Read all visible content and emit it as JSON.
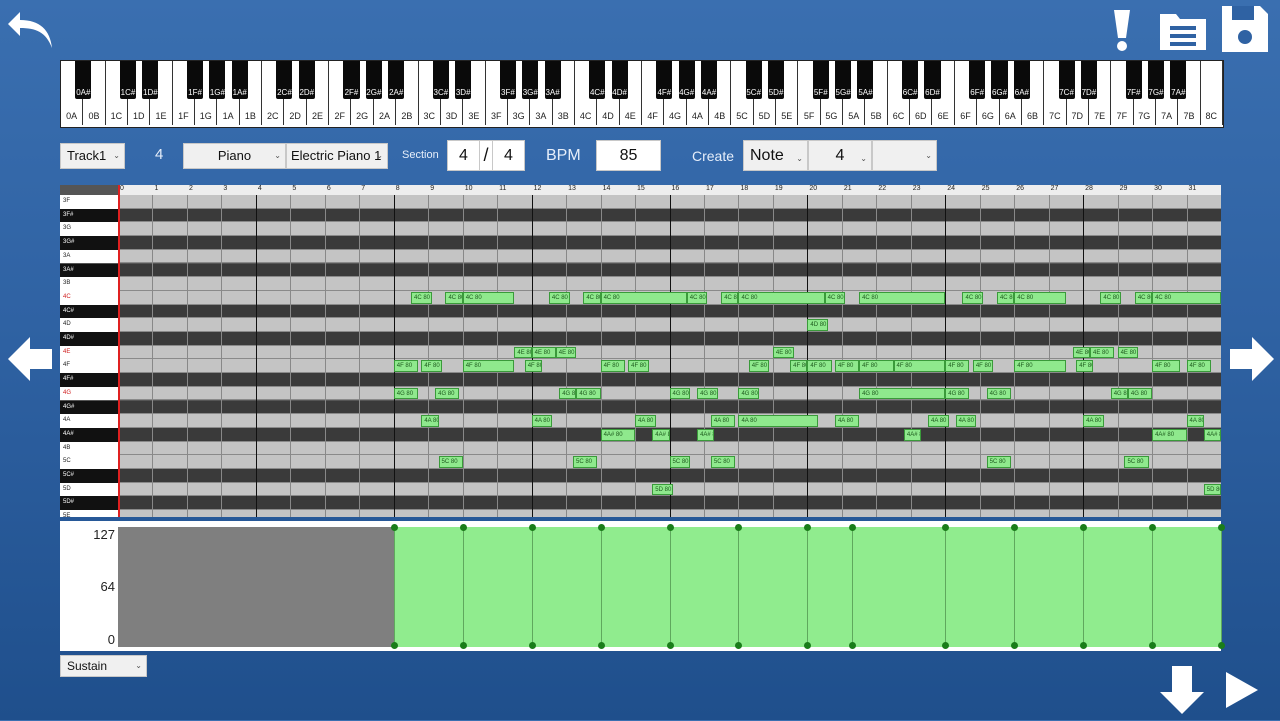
{
  "keyboard": {
    "white_keys": [
      "0A",
      "0B",
      "1C",
      "1D",
      "1E",
      "1F",
      "1G",
      "1A",
      "1B",
      "2C",
      "2D",
      "2E",
      "2F",
      "2G",
      "2A",
      "2B",
      "3C",
      "3D",
      "3E",
      "3F",
      "3G",
      "3A",
      "3B",
      "4C",
      "4D",
      "4E",
      "4F",
      "4G",
      "4A",
      "4B",
      "5C",
      "5D",
      "5E",
      "5F",
      "5G",
      "5A",
      "5B",
      "6C",
      "6D",
      "6E",
      "6F",
      "6G",
      "6A",
      "6B",
      "7C",
      "7D",
      "7E",
      "7F",
      "7G",
      "7A",
      "7B",
      "8C"
    ],
    "black_keys": [
      "0A#",
      "1C#",
      "1D#",
      "1F#",
      "1G#",
      "1A#",
      "2C#",
      "2D#",
      "2F#",
      "2G#",
      "2A#",
      "3C#",
      "3D#",
      "3F#",
      "3G#",
      "3A#",
      "4C#",
      "4D#",
      "4F#",
      "4G#",
      "4A#",
      "5C#",
      "5D#",
      "5F#",
      "5G#",
      "5A#",
      "6C#",
      "6D#",
      "6F#",
      "6G#",
      "6A#",
      "7C#",
      "7D#",
      "7F#",
      "7G#",
      "7A#"
    ]
  },
  "toolbar": {
    "track": "Track1",
    "track_number": "4",
    "instrument_category": "Piano",
    "instrument": "Electric Piano 1",
    "section_label": "Section",
    "time_sig_num": "4",
    "time_sig_slash": "/",
    "time_sig_den": "4",
    "bpm_label": "BPM",
    "bpm_value": "85",
    "create_label": "Create",
    "create_mode": "Note",
    "create_length": "4",
    "create_extra": ""
  },
  "ruler": [
    "0",
    "1",
    "2",
    "3",
    "4",
    "5",
    "6",
    "7",
    "8",
    "9",
    "10",
    "11",
    "12",
    "13",
    "14",
    "15",
    "16",
    "17",
    "18",
    "19",
    "20",
    "21",
    "22",
    "23",
    "24",
    "25",
    "26",
    "27",
    "28",
    "29",
    "30",
    "31"
  ],
  "pitches": [
    {
      "name": "3F",
      "black": false,
      "red": false
    },
    {
      "name": "3F#",
      "black": true,
      "red": false
    },
    {
      "name": "3G",
      "black": false,
      "red": false
    },
    {
      "name": "3G#",
      "black": true,
      "red": false
    },
    {
      "name": "3A",
      "black": false,
      "red": false
    },
    {
      "name": "3A#",
      "black": true,
      "red": false
    },
    {
      "name": "3B",
      "black": false,
      "red": false
    },
    {
      "name": "4C",
      "black": false,
      "red": true
    },
    {
      "name": "4C#",
      "black": true,
      "red": false
    },
    {
      "name": "4D",
      "black": false,
      "red": false
    },
    {
      "name": "4D#",
      "black": true,
      "red": false
    },
    {
      "name": "4E",
      "black": false,
      "red": true
    },
    {
      "name": "4F",
      "black": false,
      "red": false
    },
    {
      "name": "4F#",
      "black": true,
      "red": false
    },
    {
      "name": "4G",
      "black": false,
      "red": true
    },
    {
      "name": "4G#",
      "black": true,
      "red": false
    },
    {
      "name": "4A",
      "black": false,
      "red": false
    },
    {
      "name": "4A#",
      "black": true,
      "red": false
    },
    {
      "name": "4B",
      "black": false,
      "red": false
    },
    {
      "name": "5C",
      "black": false,
      "red": false
    },
    {
      "name": "5C#",
      "black": true,
      "red": false
    },
    {
      "name": "5D",
      "black": false,
      "red": false
    },
    {
      "name": "5D#",
      "black": true,
      "red": false
    },
    {
      "name": "5E",
      "black": false,
      "red": false
    }
  ],
  "notes": [
    {
      "p": "4C",
      "s": 8.5,
      "l": 0.6,
      "label": "4C 80"
    },
    {
      "p": "4C",
      "s": 9.5,
      "l": 0.5,
      "label": "4C 80"
    },
    {
      "p": "4C",
      "s": 10,
      "l": 1.5,
      "label": "4C 80"
    },
    {
      "p": "4C",
      "s": 12.5,
      "l": 0.6,
      "label": "4C 80"
    },
    {
      "p": "4C",
      "s": 13.5,
      "l": 0.5,
      "label": "4C 80"
    },
    {
      "p": "4C",
      "s": 14,
      "l": 2.5,
      "label": "4C 80"
    },
    {
      "p": "4C",
      "s": 16.5,
      "l": 0.6,
      "label": "4C 80"
    },
    {
      "p": "4C",
      "s": 17.5,
      "l": 0.5,
      "label": "4C 80"
    },
    {
      "p": "4C",
      "s": 18,
      "l": 2.5,
      "label": "4C 80"
    },
    {
      "p": "4C",
      "s": 20.5,
      "l": 0.6,
      "label": "4C 80"
    },
    {
      "p": "4C",
      "s": 21.5,
      "l": 2.5,
      "label": "4C 80"
    },
    {
      "p": "4C",
      "s": 24.5,
      "l": 0.6,
      "label": "4C 80"
    },
    {
      "p": "4C",
      "s": 25.5,
      "l": 0.5,
      "label": "4C 80"
    },
    {
      "p": "4C",
      "s": 26,
      "l": 1.5,
      "label": "4C 80"
    },
    {
      "p": "4C",
      "s": 28.5,
      "l": 0.6,
      "label": "4C 80"
    },
    {
      "p": "4C",
      "s": 29.5,
      "l": 0.5,
      "label": "4C 80"
    },
    {
      "p": "4C",
      "s": 30,
      "l": 2,
      "label": "4C 80"
    },
    {
      "p": "4D",
      "s": 20,
      "l": 0.6,
      "label": "4D 80"
    },
    {
      "p": "4E",
      "s": 11.5,
      "l": 0.5,
      "label": "4E 80"
    },
    {
      "p": "4E",
      "s": 12,
      "l": 0.7,
      "label": "4E 80"
    },
    {
      "p": "4E",
      "s": 12.7,
      "l": 0.6,
      "label": "4E 80"
    },
    {
      "p": "4E",
      "s": 19,
      "l": 0.6,
      "label": "4E 80"
    },
    {
      "p": "4E",
      "s": 27.7,
      "l": 0.5,
      "label": "4E 80"
    },
    {
      "p": "4E",
      "s": 28.2,
      "l": 0.7,
      "label": "4E 80"
    },
    {
      "p": "4E",
      "s": 29,
      "l": 0.6,
      "label": "4E 80"
    },
    {
      "p": "4F",
      "s": 8,
      "l": 0.7,
      "label": "4F 80"
    },
    {
      "p": "4F",
      "s": 8.8,
      "l": 0.6,
      "label": "4F 80"
    },
    {
      "p": "4F",
      "s": 10,
      "l": 1.5,
      "label": "4F 80"
    },
    {
      "p": "4F",
      "s": 11.8,
      "l": 0.5,
      "label": "4F 80"
    },
    {
      "p": "4F",
      "s": 14,
      "l": 0.7,
      "label": "4F 80"
    },
    {
      "p": "4F",
      "s": 14.8,
      "l": 0.6,
      "label": "4F 80"
    },
    {
      "p": "4F",
      "s": 18.3,
      "l": 0.6,
      "label": "4F 80"
    },
    {
      "p": "4F",
      "s": 19.5,
      "l": 0.5,
      "label": "4F 80"
    },
    {
      "p": "4F",
      "s": 20,
      "l": 0.7,
      "label": "4F 80"
    },
    {
      "p": "4F",
      "s": 20.8,
      "l": 0.7,
      "label": "4F 80"
    },
    {
      "p": "4F",
      "s": 21.5,
      "l": 1,
      "label": "4F 80"
    },
    {
      "p": "4F",
      "s": 22.5,
      "l": 1.5,
      "label": "4F 80"
    },
    {
      "p": "4F",
      "s": 24,
      "l": 0.7,
      "label": "4F 80"
    },
    {
      "p": "4F",
      "s": 24.8,
      "l": 0.6,
      "label": "4F 80"
    },
    {
      "p": "4F",
      "s": 26,
      "l": 1.5,
      "label": "4F 80"
    },
    {
      "p": "4F",
      "s": 27.8,
      "l": 0.5,
      "label": "4F 80"
    },
    {
      "p": "4F",
      "s": 30,
      "l": 0.8,
      "label": "4F 80"
    },
    {
      "p": "4F",
      "s": 31,
      "l": 0.7,
      "label": "4F 80"
    },
    {
      "p": "4G",
      "s": 8,
      "l": 0.7,
      "label": "4G 80"
    },
    {
      "p": "4G",
      "s": 9.2,
      "l": 0.7,
      "label": "4G 80"
    },
    {
      "p": "4G",
      "s": 12.8,
      "l": 0.5,
      "label": "4G 80"
    },
    {
      "p": "4G",
      "s": 13.3,
      "l": 0.7,
      "label": "4G 80"
    },
    {
      "p": "4G",
      "s": 16,
      "l": 0.6,
      "label": "4G 80"
    },
    {
      "p": "4G",
      "s": 16.8,
      "l": 0.6,
      "label": "4G 80"
    },
    {
      "p": "4G",
      "s": 18,
      "l": 0.6,
      "label": "4G 80"
    },
    {
      "p": "4G",
      "s": 21.5,
      "l": 2.5,
      "label": "4G 80"
    },
    {
      "p": "4G",
      "s": 24,
      "l": 0.7,
      "label": "4G 80"
    },
    {
      "p": "4G",
      "s": 25.2,
      "l": 0.7,
      "label": "4G 80"
    },
    {
      "p": "4G",
      "s": 28.8,
      "l": 0.5,
      "label": "4G 80"
    },
    {
      "p": "4G",
      "s": 29.3,
      "l": 0.7,
      "label": "4G 80"
    },
    {
      "p": "4A",
      "s": 8.8,
      "l": 0.5,
      "label": "4A 80"
    },
    {
      "p": "4A",
      "s": 12,
      "l": 0.6,
      "label": "4A 80"
    },
    {
      "p": "4A",
      "s": 15,
      "l": 0.6,
      "label": "4A 80"
    },
    {
      "p": "4A",
      "s": 17.2,
      "l": 0.7,
      "label": "4A 80"
    },
    {
      "p": "4A",
      "s": 18,
      "l": 2.3,
      "label": "4A 80"
    },
    {
      "p": "4A",
      "s": 20.8,
      "l": 0.7,
      "label": "4A 80"
    },
    {
      "p": "4A",
      "s": 23.5,
      "l": 0.6,
      "label": "4A 80"
    },
    {
      "p": "4A",
      "s": 24.3,
      "l": 0.6,
      "label": "4A 80"
    },
    {
      "p": "4A",
      "s": 28,
      "l": 0.6,
      "label": "4A 80"
    },
    {
      "p": "4A",
      "s": 31,
      "l": 0.5,
      "label": "4A 80"
    },
    {
      "p": "4A#",
      "s": 14,
      "l": 1,
      "label": "4A# 80"
    },
    {
      "p": "4A#",
      "s": 15.5,
      "l": 0.5,
      "label": "4A# 80"
    },
    {
      "p": "4A#",
      "s": 16.8,
      "l": 0.5,
      "label": "4A# 80"
    },
    {
      "p": "4A#",
      "s": 22.8,
      "l": 0.5,
      "label": "4A# 80"
    },
    {
      "p": "4A#",
      "s": 30,
      "l": 1,
      "label": "4A# 80"
    },
    {
      "p": "4A#",
      "s": 31.5,
      "l": 0.5,
      "label": "4A# 80"
    },
    {
      "p": "5C",
      "s": 9.3,
      "l": 0.7,
      "label": "5C 80"
    },
    {
      "p": "5C",
      "s": 13.2,
      "l": 0.7,
      "label": "5C 80"
    },
    {
      "p": "5C",
      "s": 16,
      "l": 0.6,
      "label": "5C 80"
    },
    {
      "p": "5C",
      "s": 17.2,
      "l": 0.7,
      "label": "5C 80"
    },
    {
      "p": "5C",
      "s": 25.2,
      "l": 0.7,
      "label": "5C 80"
    },
    {
      "p": "5C",
      "s": 29.2,
      "l": 0.7,
      "label": "5C 80"
    },
    {
      "p": "5D",
      "s": 15.5,
      "l": 0.6,
      "label": "5D 80"
    },
    {
      "p": "5D",
      "s": 31.5,
      "l": 0.5,
      "label": "5D 80"
    }
  ],
  "velocity": {
    "labels": [
      "127",
      "64",
      "0"
    ],
    "points": [
      8,
      10,
      12,
      14,
      16,
      18,
      20,
      21.3,
      24,
      26,
      28,
      30,
      32
    ]
  },
  "footer": {
    "controller": "Sustain"
  },
  "colors": {
    "accent": "#2f62a3",
    "note": "#8fe98d",
    "playhead": "#e02020"
  }
}
